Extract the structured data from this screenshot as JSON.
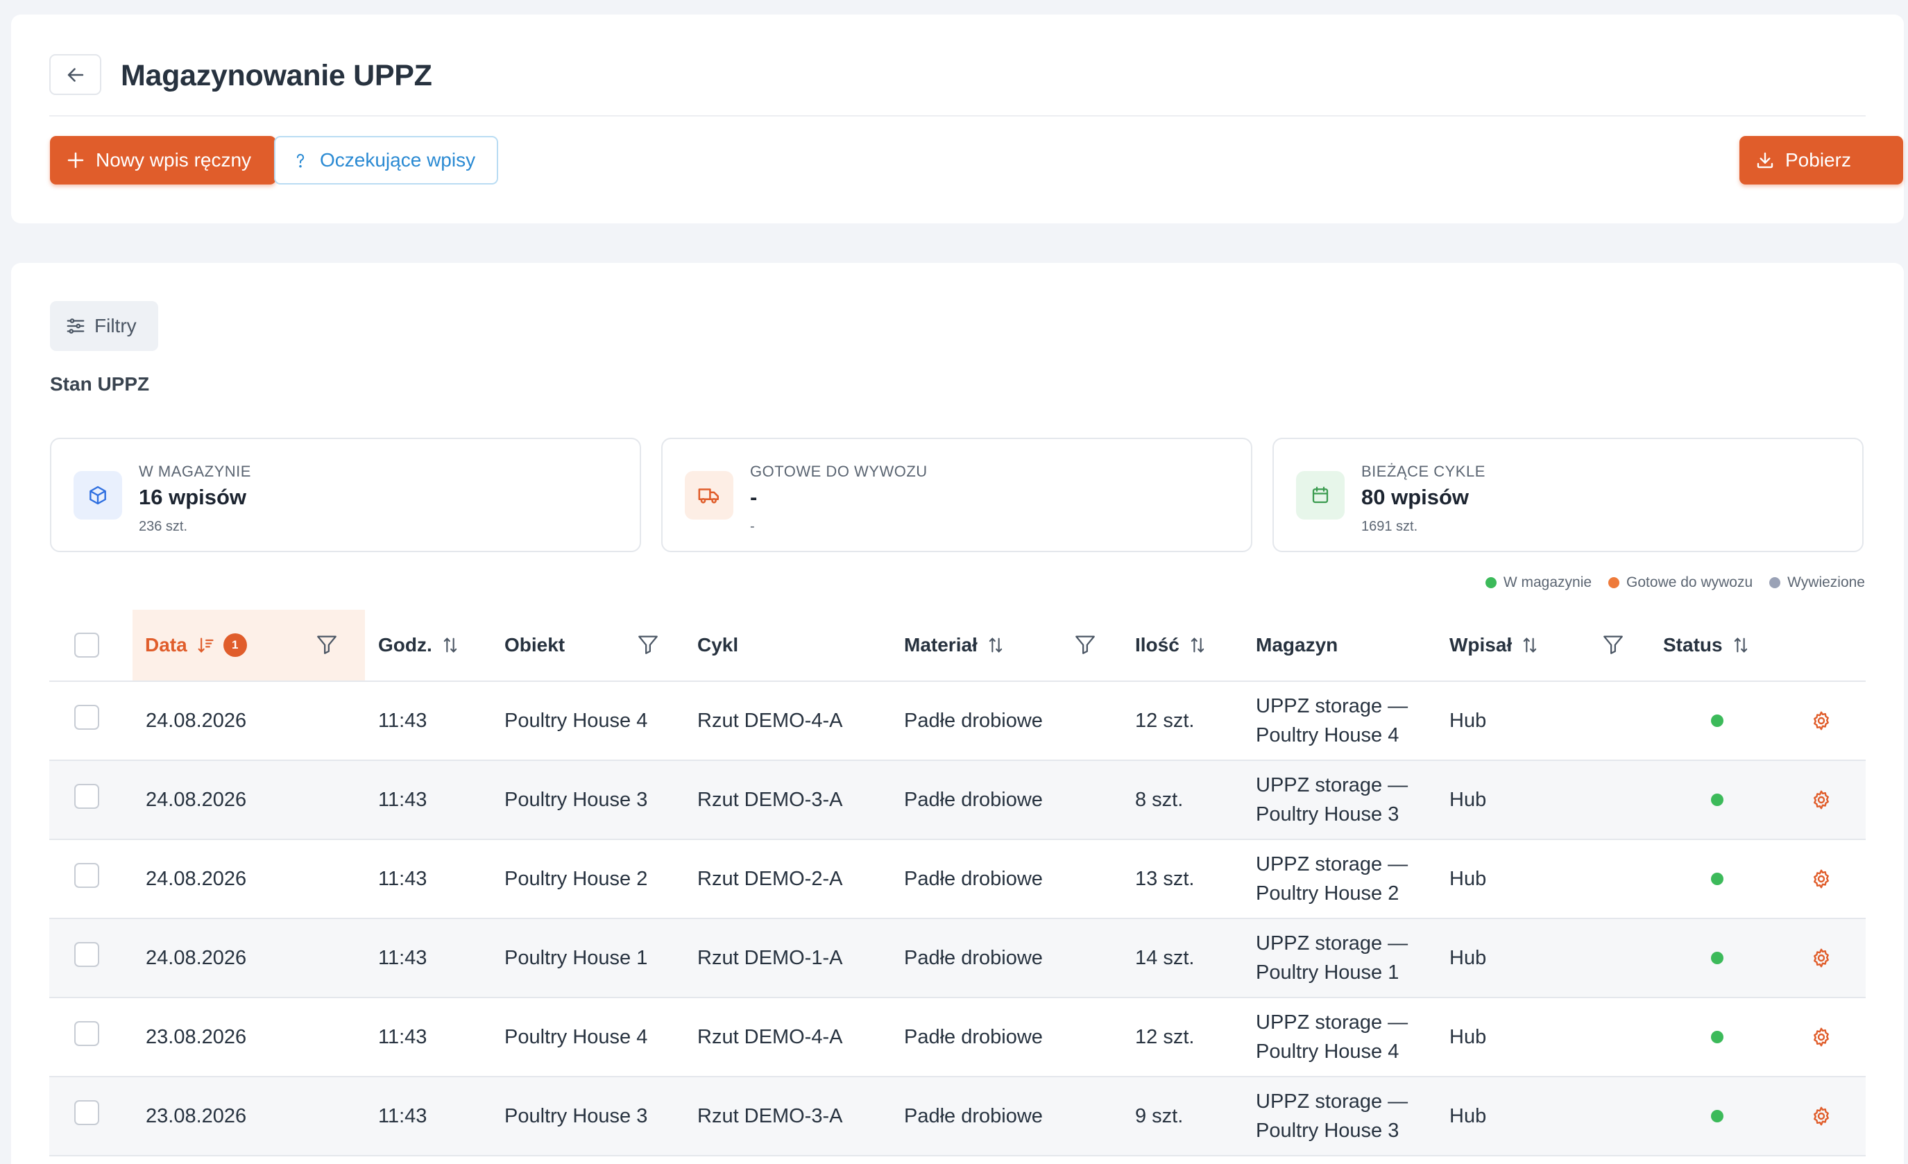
{
  "header": {
    "title": "Magazynowanie UPPZ",
    "new_entry_label": "Nowy wpis ręczny",
    "pending_label": "Oczekujące wpisy",
    "download_label": "Pobierz"
  },
  "filters": {
    "label": "Filtry"
  },
  "section": {
    "title": "Stan UPPZ"
  },
  "stats": [
    {
      "label": "W MAGAZYNIE",
      "value": "16 wpisów",
      "sub": "236 szt.",
      "icon": "box-icon"
    },
    {
      "label": "GOTOWE DO WYWOZU",
      "value": "-",
      "sub": "-",
      "icon": "truck-icon"
    },
    {
      "label": "BIEŻĄCE CYKLE",
      "value": "80 wpisów",
      "sub": "1691 szt.",
      "icon": "calendar-icon"
    }
  ],
  "legend": [
    {
      "label": "W magazynie",
      "color": "#3cba5a"
    },
    {
      "label": "Gotowe do wywozu",
      "color": "#ee7a3a"
    },
    {
      "label": "Wywiezione",
      "color": "#9aa2b6"
    }
  ],
  "table": {
    "columns": {
      "date": "Data",
      "time": "Godz.",
      "object": "Obiekt",
      "cycle": "Cykl",
      "material": "Materiał",
      "quantity": "Ilość",
      "warehouse": "Magazyn",
      "entered_by": "Wpisał",
      "status": "Status"
    },
    "sort_badge": "1",
    "rows": [
      {
        "date": "24.08.2026",
        "time": "11:43",
        "object": "Poultry House 4",
        "cycle": "Rzut DEMO-4-A",
        "material": "Padłe drobiowe",
        "quantity": "12 szt.",
        "warehouse_1": "UPPZ storage —",
        "warehouse_2": "Poultry House 4",
        "entered_by": "Hub",
        "status": "W magazynie"
      },
      {
        "date": "24.08.2026",
        "time": "11:43",
        "object": "Poultry House 3",
        "cycle": "Rzut DEMO-3-A",
        "material": "Padłe drobiowe",
        "quantity": "8 szt.",
        "warehouse_1": "UPPZ storage —",
        "warehouse_2": "Poultry House 3",
        "entered_by": "Hub",
        "status": "W magazynie"
      },
      {
        "date": "24.08.2026",
        "time": "11:43",
        "object": "Poultry House 2",
        "cycle": "Rzut DEMO-2-A",
        "material": "Padłe drobiowe",
        "quantity": "13 szt.",
        "warehouse_1": "UPPZ storage —",
        "warehouse_2": "Poultry House 2",
        "entered_by": "Hub",
        "status": "W magazynie"
      },
      {
        "date": "24.08.2026",
        "time": "11:43",
        "object": "Poultry House 1",
        "cycle": "Rzut DEMO-1-A",
        "material": "Padłe drobiowe",
        "quantity": "14 szt.",
        "warehouse_1": "UPPZ storage —",
        "warehouse_2": "Poultry House 1",
        "entered_by": "Hub",
        "status": "W magazynie"
      },
      {
        "date": "23.08.2026",
        "time": "11:43",
        "object": "Poultry House 4",
        "cycle": "Rzut DEMO-4-A",
        "material": "Padłe drobiowe",
        "quantity": "12 szt.",
        "warehouse_1": "UPPZ storage —",
        "warehouse_2": "Poultry House 4",
        "entered_by": "Hub",
        "status": "W magazynie"
      },
      {
        "date": "23.08.2026",
        "time": "11:43",
        "object": "Poultry House 3",
        "cycle": "Rzut DEMO-3-A",
        "material": "Padłe drobiowe",
        "quantity": "9 szt.",
        "warehouse_1": "UPPZ storage —",
        "warehouse_2": "Poultry House 3",
        "entered_by": "Hub",
        "status": "W magazynie"
      }
    ]
  },
  "colors": {
    "accent": "#e05d2b",
    "status_in_storage": "#3cba5a",
    "pending_border": "#b9dcf3",
    "pending_text": "#2a8ad3"
  }
}
